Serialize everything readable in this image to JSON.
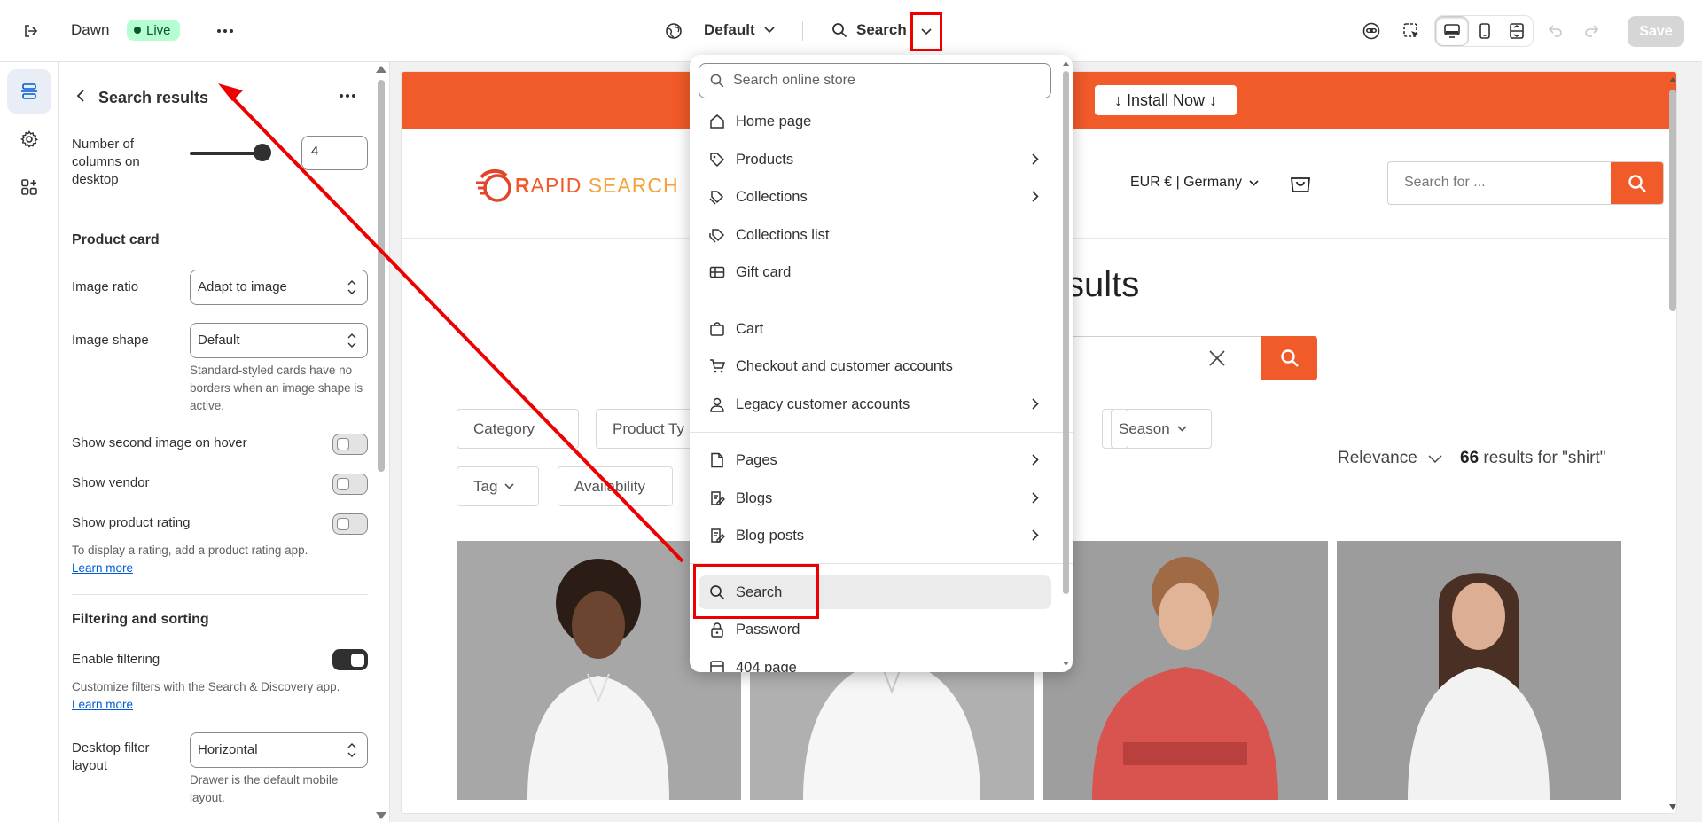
{
  "topbar": {
    "theme_name": "Dawn",
    "status": "Live",
    "context": "Default",
    "template": "Search",
    "save_label": "Save",
    "icons": [
      "exit-icon",
      "more-icon",
      "globe-icon",
      "chevron-down-icon",
      "search-icon",
      "inspector-icon",
      "select-element-icon",
      "desktop-icon",
      "mobile-icon",
      "fullscreen-icon",
      "undo-icon",
      "redo-icon"
    ]
  },
  "panel": {
    "title": "Search results",
    "columns_label": "Number of columns on desktop",
    "columns_value": "4",
    "columns_slider_value": 4,
    "product_card": "Product card",
    "image_ratio_label": "Image ratio",
    "image_ratio_value": "Adapt to image",
    "image_shape_label": "Image shape",
    "image_shape_value": "Default",
    "image_shape_help": "Standard-styled cards have no borders when an image shape is active.",
    "second_image_label": "Show second image on hover",
    "vendor_label": "Show vendor",
    "rating_label": "Show product rating",
    "rating_help": "To display a rating, add a product rating app.",
    "learn_more": "Learn more",
    "filtering_section": "Filtering and sorting",
    "enable_filtering_label": "Enable filtering",
    "filtering_help": "Customize filters with the Search & Discovery app.",
    "desktop_filter_label": "Desktop filter layout",
    "desktop_filter_value": "Horizontal",
    "desktop_filter_help": "Drawer is the default mobile layout."
  },
  "store": {
    "install_label": "↓ Install Now ↓",
    "logo_r": "R",
    "logo_apid": "APID",
    "logo_search": "SEARCH",
    "currency": "EUR € | Germany",
    "search_placeholder": "Search for ...",
    "results_title": "sults",
    "facets": [
      "Category",
      "Product Ty",
      "Season",
      "Tag",
      "Availability"
    ],
    "sort_label": "Relevance",
    "count_num": "66",
    "count_text": " results for \"shirt\""
  },
  "dropdown": {
    "search_placeholder": "Search online store",
    "items": [
      {
        "label": "Home page",
        "icon": "home-icon"
      },
      {
        "label": "Products",
        "icon": "tag-icon"
      },
      {
        "label": "Collections",
        "icon": "collection-icon"
      },
      {
        "label": "Collections list",
        "icon": "collections-list-icon"
      },
      {
        "label": "Gift card",
        "icon": "gift-card-icon"
      },
      {
        "label": "Cart",
        "icon": "bag-icon"
      },
      {
        "label": "Checkout and customer accounts",
        "icon": "cart-icon"
      },
      {
        "label": "Legacy customer accounts",
        "icon": "person-icon"
      },
      {
        "label": "Pages",
        "icon": "page-icon"
      },
      {
        "label": "Blogs",
        "icon": "blog-icon"
      },
      {
        "label": "Blog posts",
        "icon": "blog-post-icon"
      },
      {
        "label": "Search",
        "icon": "search-icon"
      },
      {
        "label": "Password",
        "icon": "lock-icon"
      },
      {
        "label": "404 page",
        "icon": "page-404-icon"
      }
    ]
  },
  "colors": {
    "accent": "#f15a29",
    "live_bg": "#b4fed2",
    "annotation": "#ee0000"
  }
}
